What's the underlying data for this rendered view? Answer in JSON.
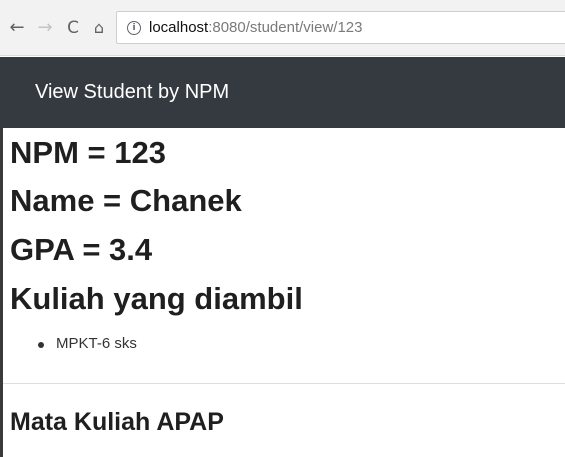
{
  "browser": {
    "url_host": "localhost",
    "url_path": ":8080/student/view/123",
    "icons": {
      "back": "arrow-left-icon",
      "forward": "arrow-right-icon",
      "reload": "reload-icon",
      "home": "home-icon",
      "info": "info-icon"
    }
  },
  "navbar": {
    "brand": "View Student by NPM",
    "background": "#343a40"
  },
  "student": {
    "npm_line": "NPM = 123",
    "name_line": "Name = Chanek",
    "gpa_line": "GPA = 3.4",
    "courses_heading": "Kuliah yang diambil",
    "courses": [
      "MPKT-6 sks"
    ]
  },
  "footer": {
    "title": "Mata Kuliah APAP"
  }
}
